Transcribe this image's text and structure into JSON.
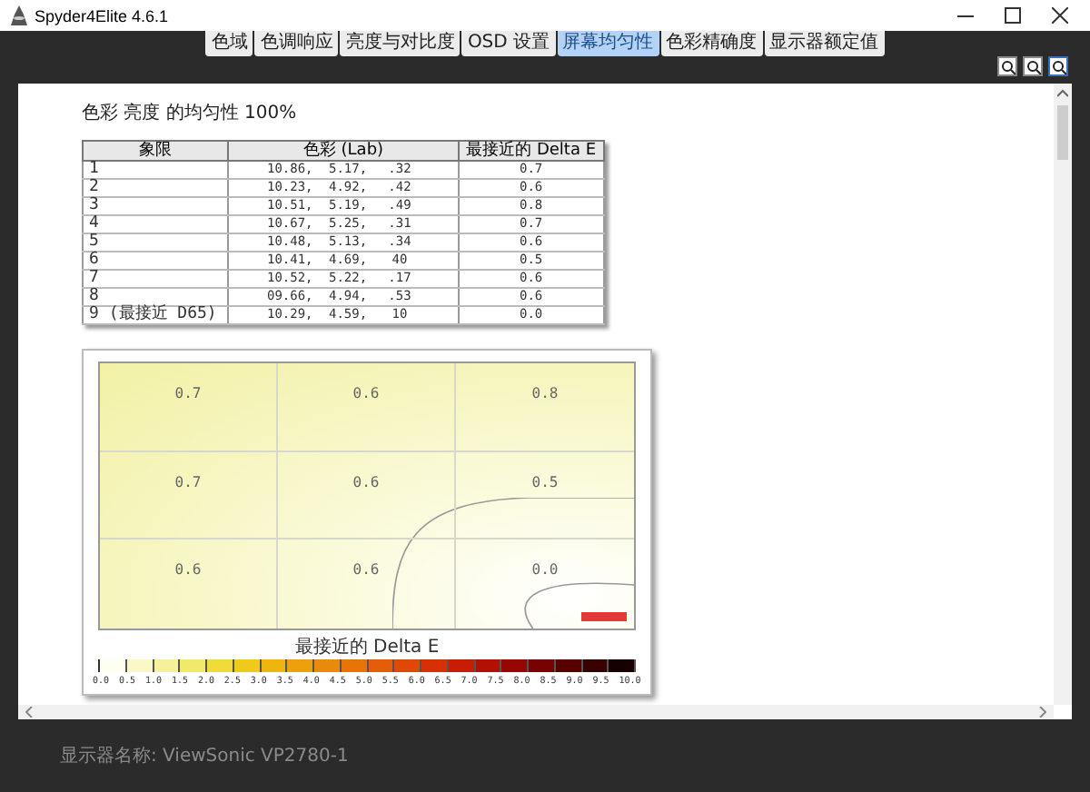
{
  "window": {
    "title": "Spyder4Elite 4.6.1"
  },
  "tabs": [
    {
      "label": "色域",
      "selected": false
    },
    {
      "label": "色调响应",
      "selected": false
    },
    {
      "label": "亮度与对比度",
      "selected": false
    },
    {
      "label": "OSD 设置",
      "selected": false
    },
    {
      "label": "屏幕均匀性",
      "selected": true
    },
    {
      "label": "色彩精确度",
      "selected": false
    },
    {
      "label": "显示器额定值",
      "selected": false
    }
  ],
  "report": {
    "title": "色彩 亮度 的均匀性 100%",
    "table": {
      "columns": [
        "象限",
        "色彩 (Lab)",
        "最接近的 Delta E"
      ],
      "rows": [
        {
          "quadrant": "1",
          "lab": [
            "10.86,",
            "5.17,",
            ".32"
          ],
          "delta_e": "0.7"
        },
        {
          "quadrant": "2",
          "lab": [
            "10.23,",
            "4.92,",
            ".42"
          ],
          "delta_e": "0.6"
        },
        {
          "quadrant": "3",
          "lab": [
            "10.51,",
            "5.19,",
            ".49"
          ],
          "delta_e": "0.8"
        },
        {
          "quadrant": "4",
          "lab": [
            "10.67,",
            "5.25,",
            ".31"
          ],
          "delta_e": "0.7"
        },
        {
          "quadrant": "5",
          "lab": [
            "10.48,",
            "5.13,",
            ".34"
          ],
          "delta_e": "0.6"
        },
        {
          "quadrant": "6",
          "lab": [
            "10.41,",
            "4.69,",
            "40"
          ],
          "delta_e": "0.5"
        },
        {
          "quadrant": "7",
          "lab": [
            "10.52,",
            "5.22,",
            ".17"
          ],
          "delta_e": "0.6"
        },
        {
          "quadrant": "8",
          "lab": [
            "09.66,",
            "4.94,",
            ".53"
          ],
          "delta_e": "0.6"
        },
        {
          "quadrant": "9 (最接近 D65)",
          "lab": [
            "10.29,",
            "4.59,",
            "10"
          ],
          "delta_e": "0.0"
        }
      ]
    },
    "heatmap": {
      "cells": [
        "0.7",
        "0.6",
        "0.8",
        "0.7",
        "0.6",
        "0.5",
        "0.6",
        "0.6",
        "0.0"
      ],
      "legend_title": "最接近的 Delta E",
      "legend_ticks": [
        "0.0",
        "0.5",
        "1.0",
        "1.5",
        "2.0",
        "2.5",
        "3.0",
        "3.5",
        "4.0",
        "4.5",
        "5.0",
        "5.5",
        "6.0",
        "6.5",
        "7.0",
        "7.5",
        "8.0",
        "8.5",
        "9.0",
        "9.5",
        "10.0"
      ]
    }
  },
  "footer": {
    "text": "显示器名称: ViewSonic VP2780-1"
  }
}
